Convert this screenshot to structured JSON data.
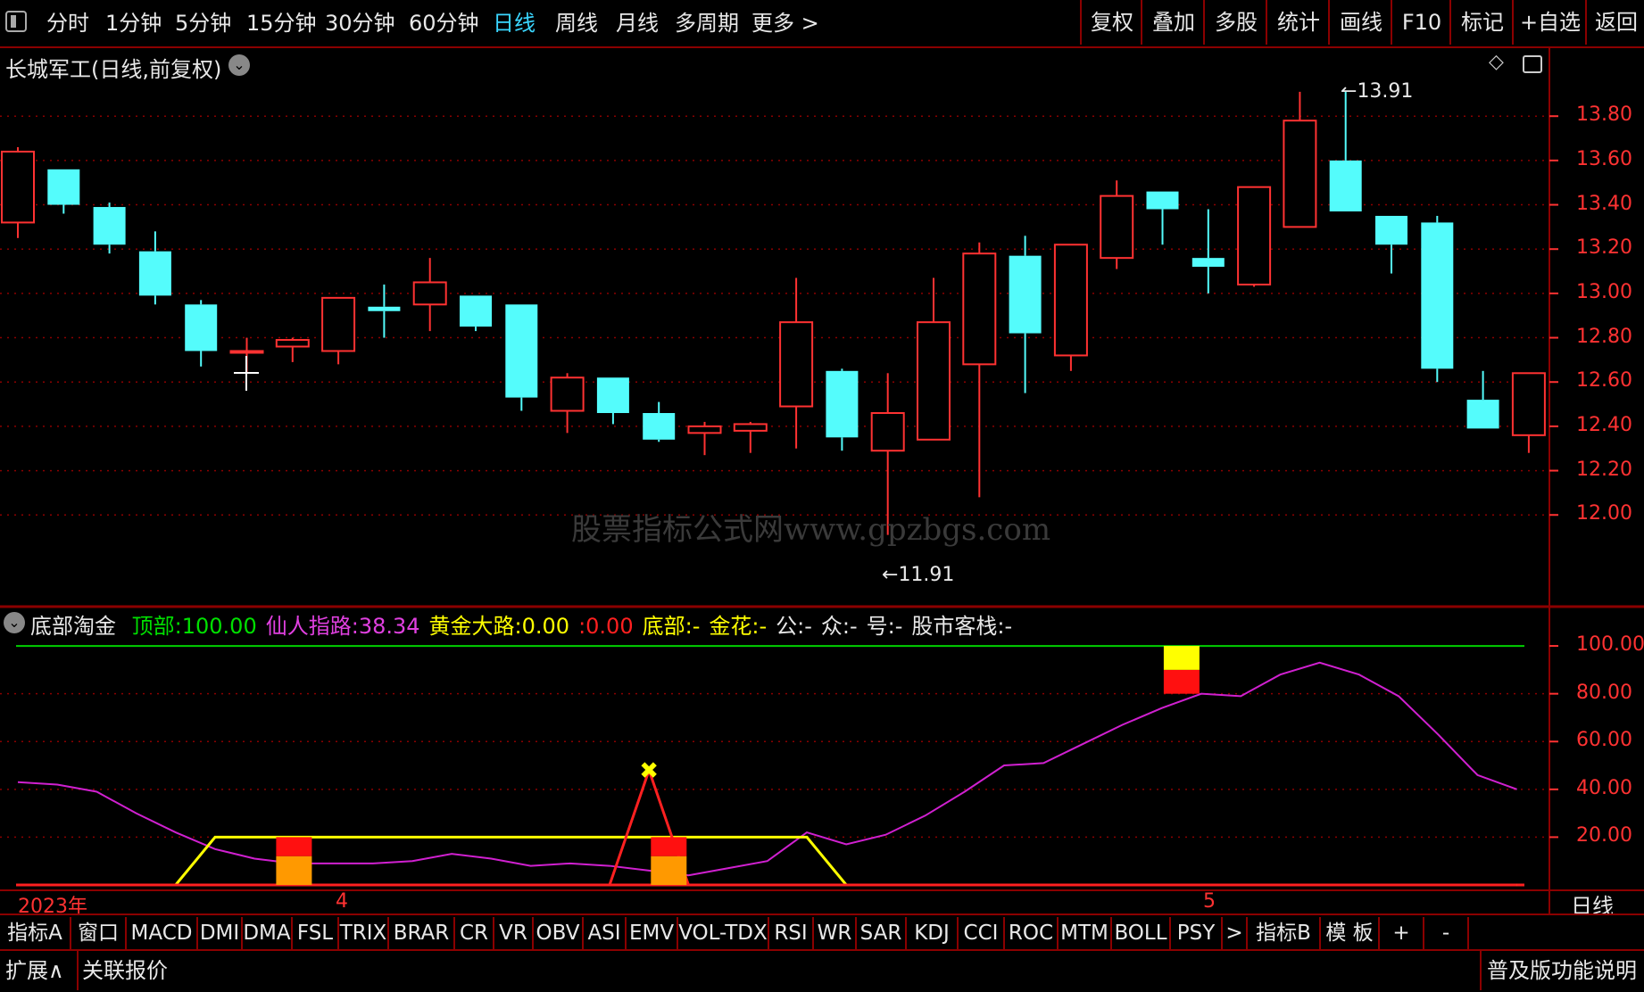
{
  "toolbar": {
    "periods": [
      "分时",
      "1分钟",
      "5分钟",
      "15分钟",
      "30分钟",
      "60分钟",
      "日线",
      "周线",
      "月线",
      "多周期",
      "更多 >"
    ],
    "active_period": "日线",
    "right_buttons": [
      "复权",
      "叠加",
      "多股",
      "统计",
      "画线",
      "F10",
      "标记",
      "+自选",
      "返回"
    ]
  },
  "main_chart": {
    "title": "长城军工(日线,前复权)",
    "high_label": "13.91",
    "low_label": "11.91",
    "watermark": "股票指标公式网www.gpzbgs.com",
    "y_ticks": [
      "13.80",
      "13.60",
      "13.40",
      "13.20",
      "13.00",
      "12.80",
      "12.60",
      "12.40",
      "12.20",
      "12.00"
    ],
    "colors": {
      "up": "#ff3232",
      "down": "#54fcfc",
      "grid": "#8b0000"
    }
  },
  "chart_data": [
    {
      "type": "candlestick",
      "ylim": [
        11.86,
        13.97
      ],
      "candles": [
        {
          "o": 13.32,
          "h": 13.66,
          "l": 13.25,
          "c": 13.64
        },
        {
          "o": 13.56,
          "h": 13.56,
          "l": 13.36,
          "c": 13.4
        },
        {
          "o": 13.39,
          "h": 13.41,
          "l": 13.18,
          "c": 13.22
        },
        {
          "o": 13.19,
          "h": 13.28,
          "l": 12.95,
          "c": 12.99
        },
        {
          "o": 12.95,
          "h": 12.97,
          "l": 12.67,
          "c": 12.74
        },
        {
          "o": 12.74,
          "h": 12.8,
          "l": 12.64,
          "c": 12.74
        },
        {
          "o": 12.76,
          "h": 12.8,
          "l": 12.69,
          "c": 12.79
        },
        {
          "o": 12.74,
          "h": 12.98,
          "l": 12.68,
          "c": 12.98
        },
        {
          "o": 12.94,
          "h": 13.04,
          "l": 12.8,
          "c": 12.92
        },
        {
          "o": 12.95,
          "h": 13.16,
          "l": 12.83,
          "c": 13.05
        },
        {
          "o": 12.99,
          "h": 12.99,
          "l": 12.83,
          "c": 12.85
        },
        {
          "o": 12.95,
          "h": 12.95,
          "l": 12.47,
          "c": 12.53
        },
        {
          "o": 12.47,
          "h": 12.64,
          "l": 12.37,
          "c": 12.62
        },
        {
          "o": 12.62,
          "h": 12.62,
          "l": 12.41,
          "c": 12.46
        },
        {
          "o": 12.46,
          "h": 12.51,
          "l": 12.33,
          "c": 12.34
        },
        {
          "o": 12.37,
          "h": 12.42,
          "l": 12.27,
          "c": 12.4
        },
        {
          "o": 12.38,
          "h": 12.42,
          "l": 12.28,
          "c": 12.41
        },
        {
          "o": 12.49,
          "h": 13.07,
          "l": 12.3,
          "c": 12.87
        },
        {
          "o": 12.65,
          "h": 12.66,
          "l": 12.29,
          "c": 12.35
        },
        {
          "o": 12.29,
          "h": 12.64,
          "l": 11.91,
          "c": 12.46
        },
        {
          "o": 12.34,
          "h": 13.07,
          "l": 12.34,
          "c": 12.87
        },
        {
          "o": 12.68,
          "h": 13.23,
          "l": 12.08,
          "c": 13.18
        },
        {
          "o": 13.17,
          "h": 13.26,
          "l": 12.55,
          "c": 12.82
        },
        {
          "o": 12.72,
          "h": 13.21,
          "l": 12.65,
          "c": 13.22
        },
        {
          "o": 13.16,
          "h": 13.51,
          "l": 13.11,
          "c": 13.44
        },
        {
          "o": 13.46,
          "h": 13.46,
          "l": 13.22,
          "c": 13.38
        },
        {
          "o": 13.16,
          "h": 13.38,
          "l": 13.0,
          "c": 13.12
        },
        {
          "o": 13.04,
          "h": 13.48,
          "l": 13.03,
          "c": 13.48
        },
        {
          "o": 13.3,
          "h": 13.91,
          "l": 13.3,
          "c": 13.78
        },
        {
          "o": 13.6,
          "h": 13.91,
          "l": 13.37,
          "c": 13.37
        },
        {
          "o": 13.35,
          "h": 13.35,
          "l": 13.09,
          "c": 13.22
        },
        {
          "o": 13.32,
          "h": 13.35,
          "l": 12.6,
          "c": 12.66
        },
        {
          "o": 12.52,
          "h": 12.65,
          "l": 12.39,
          "c": 12.39
        },
        {
          "o": 12.36,
          "h": 12.64,
          "l": 12.28,
          "c": 12.64
        }
      ]
    },
    {
      "type": "line",
      "ylim": [
        0,
        100
      ],
      "ytick_values": [
        100,
        80,
        60,
        40,
        20
      ],
      "series": [
        {
          "name": "仙人指路",
          "values": [
            43,
            42,
            39,
            30,
            22,
            15,
            11,
            9,
            9,
            9,
            10,
            13,
            11,
            8,
            9,
            8,
            6,
            4,
            7,
            10,
            22,
            17,
            21,
            29,
            39,
            50,
            51,
            59,
            67,
            74,
            80,
            79,
            88,
            93,
            88,
            79,
            63,
            46,
            40
          ]
        },
        {
          "name": "底部",
          "values": [
            0,
            0,
            0,
            0,
            0,
            20,
            20,
            20,
            20,
            20,
            20,
            20,
            20,
            20,
            20,
            20,
            20,
            20,
            20,
            20,
            20,
            0,
            0,
            0,
            0,
            0,
            0,
            0,
            0,
            0,
            0,
            0,
            0,
            0,
            0,
            0,
            0,
            0,
            0
          ]
        },
        {
          "name": "金花",
          "values": [
            0,
            0,
            0,
            0,
            0,
            0,
            0,
            0,
            0,
            0,
            0,
            0,
            0,
            0,
            0,
            0,
            48,
            0,
            0,
            0,
            0,
            0,
            0,
            0,
            0,
            0,
            0,
            0,
            0,
            0,
            0,
            0,
            0,
            0,
            0,
            0,
            0,
            0,
            0
          ]
        }
      ]
    }
  ],
  "indicator": {
    "name": "底部淘金",
    "fields": [
      {
        "label": "顶部",
        "value": "100.00",
        "color": "#00e000"
      },
      {
        "label": "仙人指路",
        "value": "38.34",
        "color": "#e040e0"
      },
      {
        "label": "黄金大路",
        "value": "0.00",
        "color": "#ffff00"
      },
      {
        "label": "",
        "value": "0.00",
        "color": "#ff2020"
      },
      {
        "label": "底部",
        "value": "-",
        "color": "#ffff00"
      },
      {
        "label": "金花",
        "value": "-",
        "color": "#ffff00"
      },
      {
        "label": "公",
        "value": "-",
        "color": "#e8e8e8"
      },
      {
        "label": "众",
        "value": "-",
        "color": "#e8e8e8"
      },
      {
        "label": "号",
        "value": "-",
        "color": "#e8e8e8"
      },
      {
        "label": "股市客栈",
        "value": "-",
        "color": "#e8e8e8"
      }
    ],
    "y_ticks": [
      "100.00",
      "80.00",
      "60.00",
      "40.00",
      "20.00"
    ]
  },
  "x_axis": {
    "year_label": "2023年",
    "month_labels": [
      "4",
      "5"
    ],
    "period_label": "日线"
  },
  "tabs": [
    "指标A",
    "窗口",
    "MACD",
    "DMI",
    "DMA",
    "FSL",
    "TRIX",
    "BRAR",
    "CR",
    "VR",
    "OBV",
    "ASI",
    "EMV",
    "VOL-TDX",
    "RSI",
    "WR",
    "SAR",
    "KDJ",
    "CCI",
    "ROC",
    "MTM",
    "BOLL",
    "PSY",
    ">",
    "指标B",
    "模 板",
    "+",
    "-"
  ],
  "status": {
    "expand": "扩展∧",
    "linked_quote": "关联报价",
    "help": "普及版功能说明"
  }
}
